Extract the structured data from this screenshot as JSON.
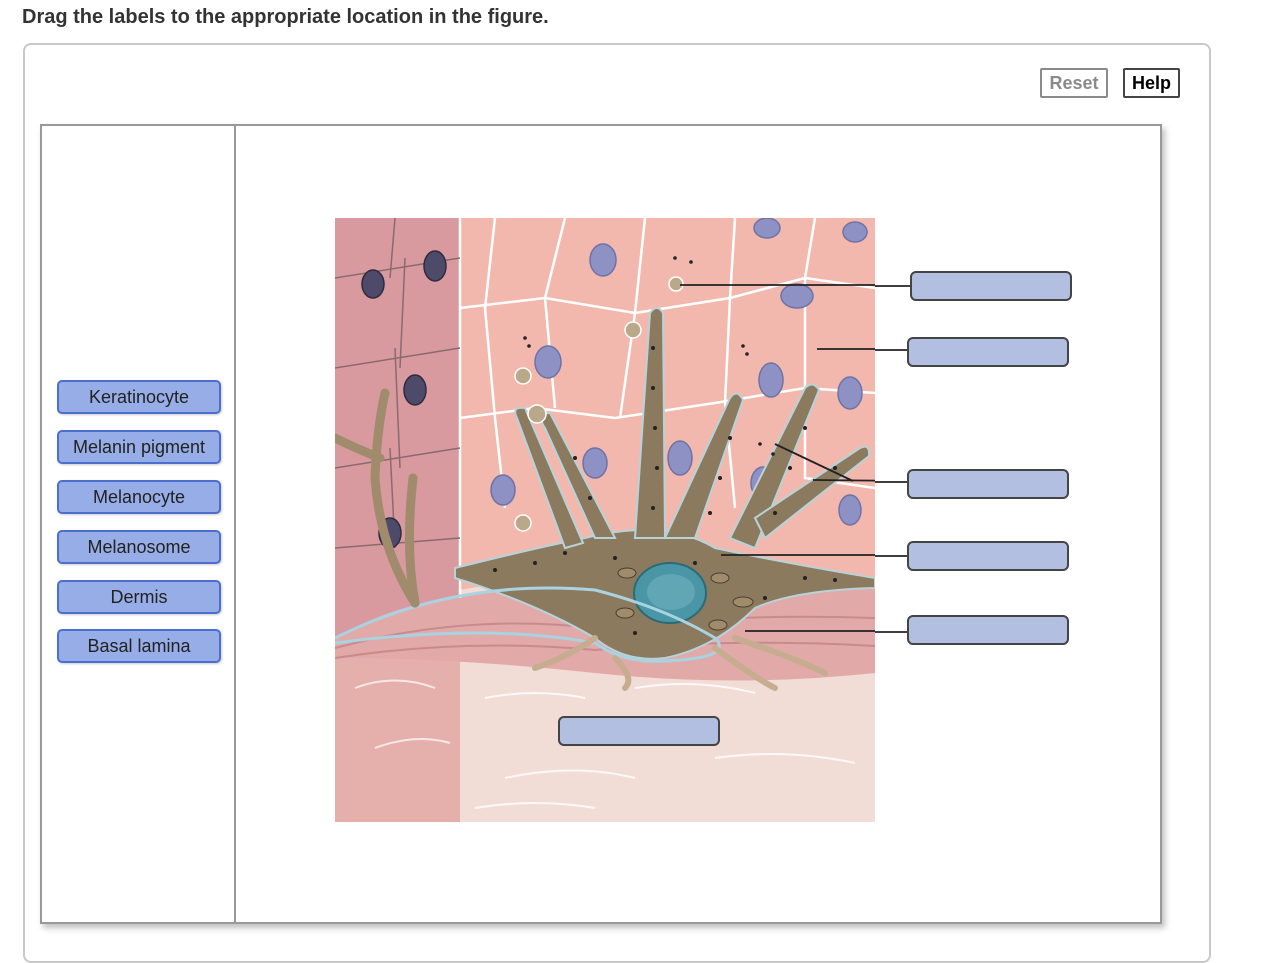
{
  "instruction": "Drag the labels to the appropriate location in the figure.",
  "buttons": {
    "reset": "Reset",
    "help": "Help"
  },
  "labels": [
    "Keratinocyte",
    "Melanin pigment",
    "Melanocyte",
    "Melanosome",
    "Dermis",
    "Basal lamina"
  ],
  "drop_targets_count": 6,
  "colors": {
    "label_fill": "#97ade8",
    "label_border": "#4a6fcf",
    "target_fill": "#b3bfe1",
    "keratinocyte_pink": "#f3b8ad",
    "melanocyte_brown": "#8b7a5e",
    "nucleus_teal": "#4a96a6"
  }
}
